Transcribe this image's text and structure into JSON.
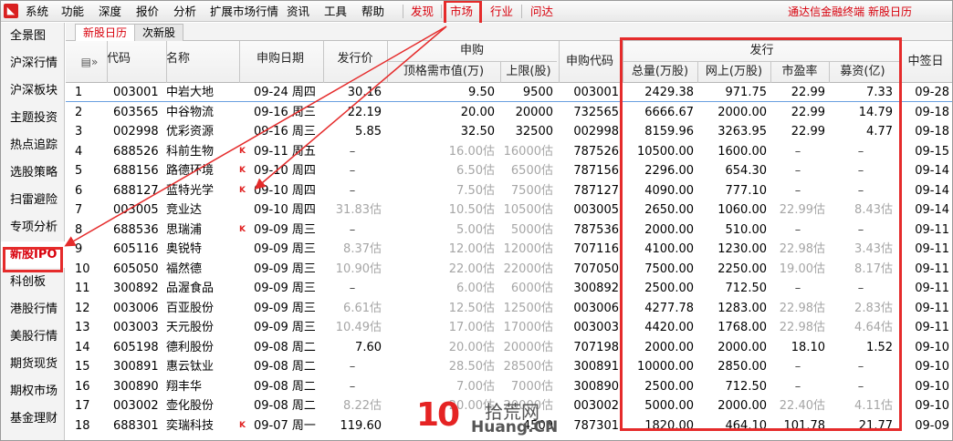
{
  "menubar": {
    "items": [
      "系统",
      "功能",
      "深度",
      "报价",
      "分析",
      "扩展市场行情",
      "资讯",
      "工具",
      "帮助"
    ],
    "right_items": [
      "发现",
      "市场",
      "行业",
      "问达"
    ],
    "brand": "通达信金融终端 新股日历"
  },
  "sidebar": {
    "items": [
      "全景图",
      "沪深行情",
      "沪深板块",
      "主题投资",
      "热点追踪",
      "选股策略",
      "扫雷避险",
      "专项分析",
      "新股IPO",
      "科创板",
      "港股行情",
      "美股行情",
      "期货现货",
      "期权市场",
      "基金理财"
    ],
    "active": "新股IPO"
  },
  "tabs": [
    "新股日历",
    "次新股"
  ],
  "table": {
    "headers": {
      "menu_icon": "▤»",
      "code": "代码",
      "name": "名称",
      "subscribe_date": "申购日期",
      "issue_price": "发行价",
      "subscribe_group": "申购",
      "top_market_value": "顶格需市值(万)",
      "upper_limit": "上限(股)",
      "subscribe_code": "申购代码",
      "issue_group": "发行",
      "total_amount": "总量(万股)",
      "online_amount": "网上(万股)",
      "pe": "市盈率",
      "funds_raised": "募资(亿)",
      "lottery_date": "中签日"
    },
    "rows": [
      {
        "no": "1",
        "code": "003001",
        "name": "中岩大地",
        "k": false,
        "date": "09-24 周四",
        "price": "30.16",
        "price_est": false,
        "mv": "9.50",
        "mv_est": false,
        "limit": "9500",
        "limit_est": false,
        "scode": "003001",
        "total": "2429.38",
        "online": "971.75",
        "pe": "22.99",
        "pe_est": false,
        "funds": "7.33",
        "funds_est": false,
        "lottery": "09-28"
      },
      {
        "no": "2",
        "code": "603565",
        "name": "中谷物流",
        "k": false,
        "date": "09-16 周三",
        "price": "22.19",
        "price_est": false,
        "mv": "20.00",
        "mv_est": false,
        "limit": "20000",
        "limit_est": false,
        "scode": "732565",
        "total": "6666.67",
        "online": "2000.00",
        "pe": "22.99",
        "pe_est": false,
        "funds": "14.79",
        "funds_est": false,
        "lottery": "09-18"
      },
      {
        "no": "3",
        "code": "002998",
        "name": "优彩资源",
        "k": false,
        "date": "09-16 周三",
        "price": "5.85",
        "price_est": false,
        "mv": "32.50",
        "mv_est": false,
        "limit": "32500",
        "limit_est": false,
        "scode": "002998",
        "total": "8159.96",
        "online": "3263.95",
        "pe": "22.99",
        "pe_est": false,
        "funds": "4.77",
        "funds_est": false,
        "lottery": "09-18"
      },
      {
        "no": "4",
        "code": "688526",
        "name": "科前生物",
        "k": true,
        "date": "09-11 周五",
        "price": "–",
        "price_est": false,
        "mv": "16.00估",
        "mv_est": true,
        "limit": "16000估",
        "limit_est": true,
        "scode": "787526",
        "total": "10500.00",
        "online": "1600.00",
        "pe": "–",
        "pe_est": false,
        "funds": "–",
        "funds_est": false,
        "lottery": "09-15"
      },
      {
        "no": "5",
        "code": "688156",
        "name": "路德环境",
        "k": true,
        "date": "09-10 周四",
        "price": "–",
        "price_est": false,
        "mv": "6.50估",
        "mv_est": true,
        "limit": "6500估",
        "limit_est": true,
        "scode": "787156",
        "total": "2296.00",
        "online": "654.30",
        "pe": "–",
        "pe_est": false,
        "funds": "–",
        "funds_est": false,
        "lottery": "09-14"
      },
      {
        "no": "6",
        "code": "688127",
        "name": "蓝特光学",
        "k": true,
        "date": "09-10 周四",
        "price": "–",
        "price_est": false,
        "mv": "7.50估",
        "mv_est": true,
        "limit": "7500估",
        "limit_est": true,
        "scode": "787127",
        "total": "4090.00",
        "online": "777.10",
        "pe": "–",
        "pe_est": false,
        "funds": "–",
        "funds_est": false,
        "lottery": "09-14"
      },
      {
        "no": "7",
        "code": "003005",
        "name": "竞业达",
        "k": false,
        "date": "09-10 周四",
        "price": "31.83估",
        "price_est": true,
        "mv": "10.50估",
        "mv_est": true,
        "limit": "10500估",
        "limit_est": true,
        "scode": "003005",
        "total": "2650.00",
        "online": "1060.00",
        "pe": "22.99估",
        "pe_est": true,
        "funds": "8.43估",
        "funds_est": true,
        "lottery": "09-14"
      },
      {
        "no": "8",
        "code": "688536",
        "name": "思瑞浦",
        "k": true,
        "date": "09-09 周三",
        "price": "–",
        "price_est": false,
        "mv": "5.00估",
        "mv_est": true,
        "limit": "5000估",
        "limit_est": true,
        "scode": "787536",
        "total": "2000.00",
        "online": "510.00",
        "pe": "–",
        "pe_est": false,
        "funds": "–",
        "funds_est": false,
        "lottery": "09-11"
      },
      {
        "no": "9",
        "code": "605116",
        "name": "奥锐特",
        "k": false,
        "date": "09-09 周三",
        "price": "8.37估",
        "price_est": true,
        "mv": "12.00估",
        "mv_est": true,
        "limit": "12000估",
        "limit_est": true,
        "scode": "707116",
        "total": "4100.00",
        "online": "1230.00",
        "pe": "22.98估",
        "pe_est": true,
        "funds": "3.43估",
        "funds_est": true,
        "lottery": "09-11"
      },
      {
        "no": "10",
        "code": "605050",
        "name": "福然德",
        "k": false,
        "date": "09-09 周三",
        "price": "10.90估",
        "price_est": true,
        "mv": "22.00估",
        "mv_est": true,
        "limit": "22000估",
        "limit_est": true,
        "scode": "707050",
        "total": "7500.00",
        "online": "2250.00",
        "pe": "19.00估",
        "pe_est": true,
        "funds": "8.17估",
        "funds_est": true,
        "lottery": "09-11"
      },
      {
        "no": "11",
        "code": "300892",
        "name": "品渥食品",
        "k": false,
        "date": "09-09 周三",
        "price": "–",
        "price_est": false,
        "mv": "6.00估",
        "mv_est": true,
        "limit": "6000估",
        "limit_est": true,
        "scode": "300892",
        "total": "2500.00",
        "online": "712.50",
        "pe": "–",
        "pe_est": false,
        "funds": "–",
        "funds_est": false,
        "lottery": "09-11"
      },
      {
        "no": "12",
        "code": "003006",
        "name": "百亚股份",
        "k": false,
        "date": "09-09 周三",
        "price": "6.61估",
        "price_est": true,
        "mv": "12.50估",
        "mv_est": true,
        "limit": "12500估",
        "limit_est": true,
        "scode": "003006",
        "total": "4277.78",
        "online": "1283.00",
        "pe": "22.98估",
        "pe_est": true,
        "funds": "2.83估",
        "funds_est": true,
        "lottery": "09-11"
      },
      {
        "no": "13",
        "code": "003003",
        "name": "天元股份",
        "k": false,
        "date": "09-09 周三",
        "price": "10.49估",
        "price_est": true,
        "mv": "17.00估",
        "mv_est": true,
        "limit": "17000估",
        "limit_est": true,
        "scode": "003003",
        "total": "4420.00",
        "online": "1768.00",
        "pe": "22.98估",
        "pe_est": true,
        "funds": "4.64估",
        "funds_est": true,
        "lottery": "09-11"
      },
      {
        "no": "14",
        "code": "605198",
        "name": "德利股份",
        "k": false,
        "date": "09-08 周二",
        "price": "7.60",
        "price_est": false,
        "mv": "20.00估",
        "mv_est": true,
        "limit": "20000估",
        "limit_est": true,
        "scode": "707198",
        "total": "2000.00",
        "online": "2000.00",
        "pe": "18.10",
        "pe_est": false,
        "funds": "1.52",
        "funds_est": false,
        "lottery": "09-10"
      },
      {
        "no": "15",
        "code": "300891",
        "name": "惠云钛业",
        "k": false,
        "date": "09-08 周二",
        "price": "–",
        "price_est": false,
        "mv": "28.50估",
        "mv_est": true,
        "limit": "28500估",
        "limit_est": true,
        "scode": "300891",
        "total": "10000.00",
        "online": "2850.00",
        "pe": "–",
        "pe_est": false,
        "funds": "–",
        "funds_est": false,
        "lottery": "09-10"
      },
      {
        "no": "16",
        "code": "300890",
        "name": "翔丰华",
        "k": false,
        "date": "09-08 周二",
        "price": "–",
        "price_est": false,
        "mv": "7.00估",
        "mv_est": true,
        "limit": "7000估",
        "limit_est": true,
        "scode": "300890",
        "total": "2500.00",
        "online": "712.50",
        "pe": "–",
        "pe_est": false,
        "funds": "–",
        "funds_est": false,
        "lottery": "09-10"
      },
      {
        "no": "17",
        "code": "003002",
        "name": "壶化股份",
        "k": false,
        "date": "09-08 周二",
        "price": "8.22估",
        "price_est": true,
        "mv": "20.00估",
        "mv_est": true,
        "limit": "20000估",
        "limit_est": true,
        "scode": "003002",
        "total": "5000.00",
        "online": "2000.00",
        "pe": "22.40估",
        "pe_est": true,
        "funds": "4.11估",
        "funds_est": true,
        "lottery": "09-10"
      },
      {
        "no": "18",
        "code": "688301",
        "name": "奕瑞科技",
        "k": true,
        "date": "09-07 周一",
        "price": "119.60",
        "price_est": false,
        "mv": "",
        "mv_est": false,
        "limit": "4500",
        "limit_est": false,
        "scode": "787301",
        "total": "1820.00",
        "online": "464.10",
        "pe": "101.78",
        "pe_est": false,
        "funds": "21.77",
        "funds_est": false,
        "lottery": "09-09"
      }
    ]
  },
  "watermark": {
    "mark": "10",
    "cn": "拾荒网",
    "en": "Huang.CN"
  },
  "colors": {
    "accent_red": "#d8000c",
    "highlight_box": "#e52b2b",
    "estimate_gray": "#a6a6a6",
    "selection_blue": "#6aa0e0"
  }
}
